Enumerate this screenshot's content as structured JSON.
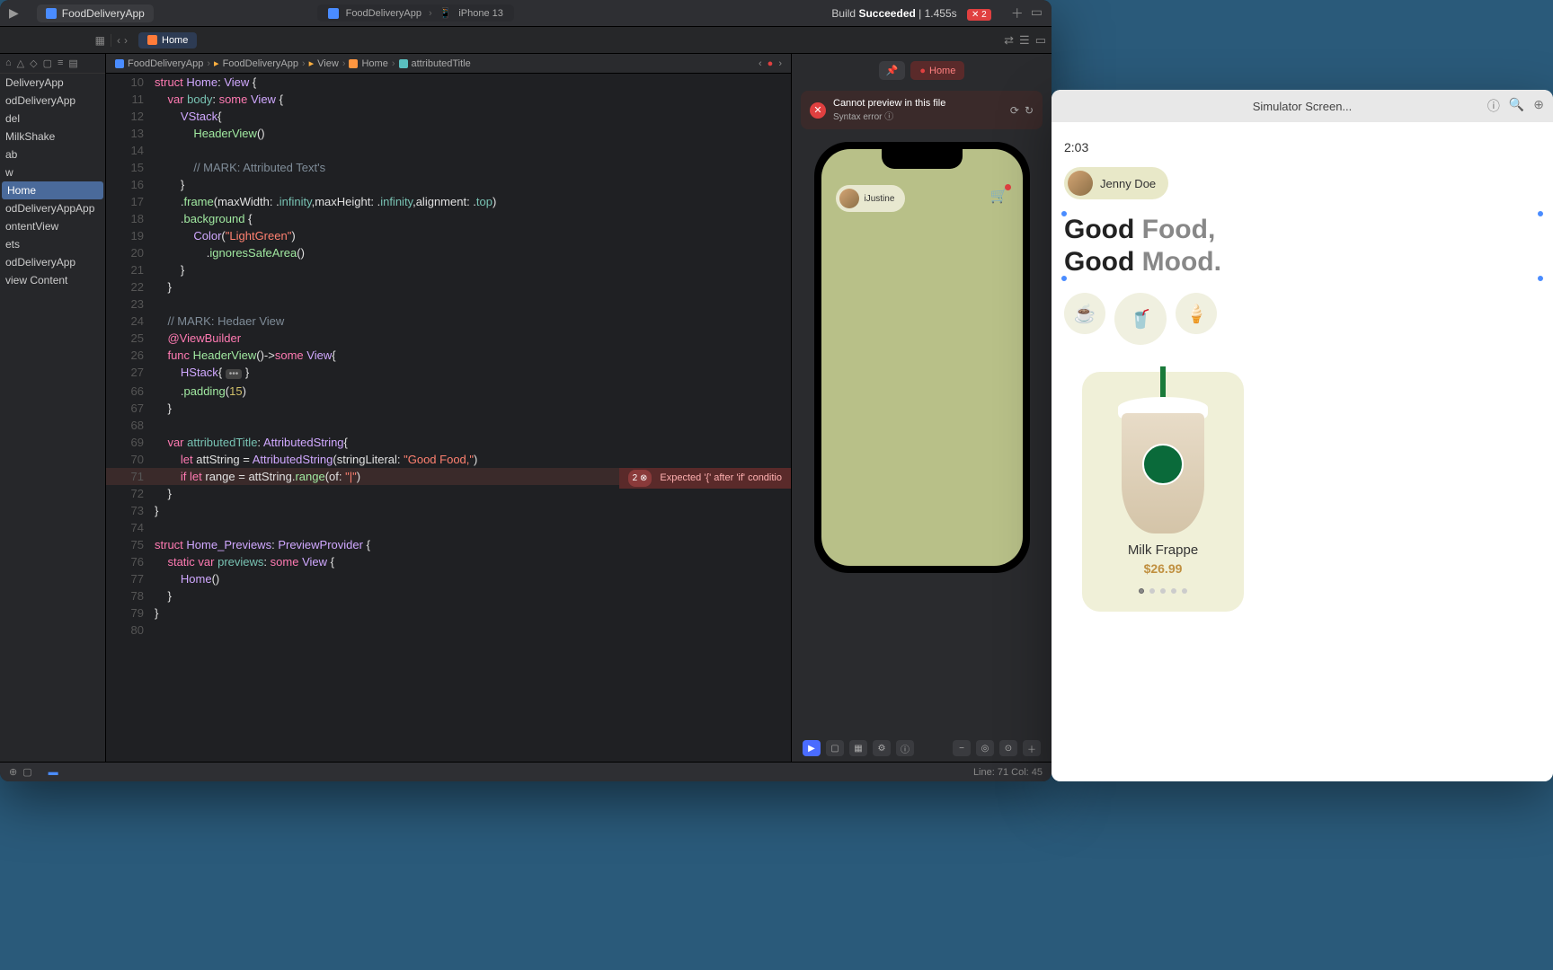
{
  "toolbar": {
    "project_name": "FoodDeliveryApp",
    "target_app": "FoodDeliveryApp",
    "target_device": "iPhone 13",
    "build_prefix": "Build",
    "build_status": "Succeeded",
    "build_time": "1.455s",
    "error_count": "2"
  },
  "tab": {
    "open_file": "Home"
  },
  "breadcrumb": {
    "items": [
      "FoodDeliveryApp",
      "FoodDeliveryApp",
      "View",
      "Home",
      "attributedTitle"
    ]
  },
  "sidebar": {
    "items": [
      "DeliveryApp",
      "odDeliveryApp",
      "del",
      "MilkShake",
      "ab",
      "w",
      "Home",
      "odDeliveryAppApp",
      "ontentView",
      "ets",
      "odDeliveryApp",
      "view Content"
    ],
    "selected_index": 6
  },
  "code": {
    "lines": [
      {
        "n": 10,
        "tokens": [
          {
            "t": "kw",
            "v": "struct"
          },
          {
            "t": "plain",
            "v": " "
          },
          {
            "t": "type",
            "v": "Home"
          },
          {
            "t": "plain",
            "v": ": "
          },
          {
            "t": "type",
            "v": "View"
          },
          {
            "t": "plain",
            "v": " {"
          }
        ]
      },
      {
        "n": 11,
        "tokens": [
          {
            "t": "plain",
            "v": "    "
          },
          {
            "t": "kw",
            "v": "var"
          },
          {
            "t": "plain",
            "v": " "
          },
          {
            "t": "ident",
            "v": "body"
          },
          {
            "t": "plain",
            "v": ": "
          },
          {
            "t": "kw",
            "v": "some"
          },
          {
            "t": "plain",
            "v": " "
          },
          {
            "t": "type",
            "v": "View"
          },
          {
            "t": "plain",
            "v": " {"
          }
        ]
      },
      {
        "n": 12,
        "tokens": [
          {
            "t": "plain",
            "v": "        "
          },
          {
            "t": "type",
            "v": "VStack"
          },
          {
            "t": "plain",
            "v": "{"
          }
        ]
      },
      {
        "n": 13,
        "tokens": [
          {
            "t": "plain",
            "v": "            "
          },
          {
            "t": "func",
            "v": "HeaderView"
          },
          {
            "t": "plain",
            "v": "()"
          }
        ]
      },
      {
        "n": 14,
        "tokens": [
          {
            "t": "plain",
            "v": ""
          }
        ]
      },
      {
        "n": 15,
        "tokens": [
          {
            "t": "plain",
            "v": "            "
          },
          {
            "t": "comment",
            "v": "// MARK: Attributed Text's"
          }
        ]
      },
      {
        "n": 16,
        "tokens": [
          {
            "t": "plain",
            "v": "        }"
          }
        ]
      },
      {
        "n": 17,
        "tokens": [
          {
            "t": "plain",
            "v": "        ."
          },
          {
            "t": "func",
            "v": "frame"
          },
          {
            "t": "plain",
            "v": "(maxWidth: ."
          },
          {
            "t": "ident",
            "v": "infinity"
          },
          {
            "t": "plain",
            "v": ",maxHeight: ."
          },
          {
            "t": "ident",
            "v": "infinity"
          },
          {
            "t": "plain",
            "v": ",alignment: ."
          },
          {
            "t": "ident",
            "v": "top"
          },
          {
            "t": "plain",
            "v": ")"
          }
        ]
      },
      {
        "n": 18,
        "tokens": [
          {
            "t": "plain",
            "v": "        ."
          },
          {
            "t": "func",
            "v": "background"
          },
          {
            "t": "plain",
            "v": " {"
          }
        ]
      },
      {
        "n": 19,
        "tokens": [
          {
            "t": "plain",
            "v": "            "
          },
          {
            "t": "type",
            "v": "Color"
          },
          {
            "t": "plain",
            "v": "("
          },
          {
            "t": "str",
            "v": "\"LightGreen\""
          },
          {
            "t": "plain",
            "v": ")"
          }
        ]
      },
      {
        "n": 20,
        "tokens": [
          {
            "t": "plain",
            "v": "                ."
          },
          {
            "t": "func",
            "v": "ignoresSafeArea"
          },
          {
            "t": "plain",
            "v": "()"
          }
        ]
      },
      {
        "n": 21,
        "tokens": [
          {
            "t": "plain",
            "v": "        }"
          }
        ]
      },
      {
        "n": 22,
        "tokens": [
          {
            "t": "plain",
            "v": "    }"
          }
        ]
      },
      {
        "n": 23,
        "tokens": [
          {
            "t": "plain",
            "v": ""
          }
        ]
      },
      {
        "n": 24,
        "tokens": [
          {
            "t": "plain",
            "v": "    "
          },
          {
            "t": "comment",
            "v": "// MARK: Hedaer View"
          }
        ]
      },
      {
        "n": 25,
        "tokens": [
          {
            "t": "plain",
            "v": "    "
          },
          {
            "t": "kw",
            "v": "@ViewBuilder"
          }
        ]
      },
      {
        "n": 26,
        "tokens": [
          {
            "t": "plain",
            "v": "    "
          },
          {
            "t": "kw",
            "v": "func"
          },
          {
            "t": "plain",
            "v": " "
          },
          {
            "t": "func",
            "v": "HeaderView"
          },
          {
            "t": "plain",
            "v": "()->"
          },
          {
            "t": "kw",
            "v": "some"
          },
          {
            "t": "plain",
            "v": " "
          },
          {
            "t": "type",
            "v": "View"
          },
          {
            "t": "plain",
            "v": "{"
          }
        ]
      },
      {
        "n": 27,
        "fold": true,
        "tokens": [
          {
            "t": "plain",
            "v": "        "
          },
          {
            "t": "type",
            "v": "HStack"
          },
          {
            "t": "plain",
            "v": "{ "
          },
          {
            "t": "fold",
            "v": "•••"
          },
          {
            "t": "plain",
            "v": " }"
          }
        ]
      },
      {
        "n": 66,
        "tokens": [
          {
            "t": "plain",
            "v": "        ."
          },
          {
            "t": "func",
            "v": "padding"
          },
          {
            "t": "plain",
            "v": "("
          },
          {
            "t": "num",
            "v": "15"
          },
          {
            "t": "plain",
            "v": ")"
          }
        ]
      },
      {
        "n": 67,
        "tokens": [
          {
            "t": "plain",
            "v": "    }"
          }
        ]
      },
      {
        "n": 68,
        "tokens": [
          {
            "t": "plain",
            "v": ""
          }
        ]
      },
      {
        "n": 69,
        "tokens": [
          {
            "t": "plain",
            "v": "    "
          },
          {
            "t": "kw",
            "v": "var"
          },
          {
            "t": "plain",
            "v": " "
          },
          {
            "t": "ident",
            "v": "attributedTitle"
          },
          {
            "t": "plain",
            "v": ": "
          },
          {
            "t": "type",
            "v": "AttributedString"
          },
          {
            "t": "plain",
            "v": "{"
          }
        ]
      },
      {
        "n": 70,
        "tokens": [
          {
            "t": "plain",
            "v": "        "
          },
          {
            "t": "kw",
            "v": "let"
          },
          {
            "t": "plain",
            "v": " attString = "
          },
          {
            "t": "type",
            "v": "AttributedString"
          },
          {
            "t": "plain",
            "v": "(stringLiteral: "
          },
          {
            "t": "str",
            "v": "\"Good Food,\""
          },
          {
            "t": "plain",
            "v": ")"
          }
        ]
      },
      {
        "n": 71,
        "err": true,
        "tokens": [
          {
            "t": "plain",
            "v": "        "
          },
          {
            "t": "kw",
            "v": "if"
          },
          {
            "t": "plain",
            "v": " "
          },
          {
            "t": "kw",
            "v": "let"
          },
          {
            "t": "plain",
            "v": " range = attString."
          },
          {
            "t": "func",
            "v": "range"
          },
          {
            "t": "plain",
            "v": "(of: "
          },
          {
            "t": "str",
            "v": "\"|\""
          },
          {
            "t": "plain",
            "v": ")"
          }
        ]
      },
      {
        "n": 72,
        "tokens": [
          {
            "t": "plain",
            "v": "    }"
          }
        ]
      },
      {
        "n": 73,
        "tokens": [
          {
            "t": "plain",
            "v": "}"
          }
        ]
      },
      {
        "n": 74,
        "tokens": [
          {
            "t": "plain",
            "v": ""
          }
        ]
      },
      {
        "n": 75,
        "tokens": [
          {
            "t": "kw",
            "v": "struct"
          },
          {
            "t": "plain",
            "v": " "
          },
          {
            "t": "type",
            "v": "Home_Previews"
          },
          {
            "t": "plain",
            "v": ": "
          },
          {
            "t": "type",
            "v": "PreviewProvider"
          },
          {
            "t": "plain",
            "v": " {"
          }
        ]
      },
      {
        "n": 76,
        "tokens": [
          {
            "t": "plain",
            "v": "    "
          },
          {
            "t": "kw",
            "v": "static"
          },
          {
            "t": "plain",
            "v": " "
          },
          {
            "t": "kw",
            "v": "var"
          },
          {
            "t": "plain",
            "v": " "
          },
          {
            "t": "ident",
            "v": "previews"
          },
          {
            "t": "plain",
            "v": ": "
          },
          {
            "t": "kw",
            "v": "some"
          },
          {
            "t": "plain",
            "v": " "
          },
          {
            "t": "type",
            "v": "View"
          },
          {
            "t": "plain",
            "v": " {"
          }
        ]
      },
      {
        "n": 77,
        "tokens": [
          {
            "t": "plain",
            "v": "        "
          },
          {
            "t": "type",
            "v": "Home"
          },
          {
            "t": "plain",
            "v": "()"
          }
        ]
      },
      {
        "n": 78,
        "tokens": [
          {
            "t": "plain",
            "v": "    }"
          }
        ]
      },
      {
        "n": 79,
        "tokens": [
          {
            "t": "plain",
            "v": "}"
          }
        ]
      },
      {
        "n": 80,
        "tokens": [
          {
            "t": "plain",
            "v": ""
          }
        ]
      }
    ],
    "inline_error": {
      "line": 71,
      "count": "2",
      "msg": "Expected '{' after 'if' conditio"
    }
  },
  "canvas": {
    "home_label": "Home",
    "banner_title": "Cannot preview in this file",
    "banner_sub": "Syntax error",
    "preview_user": "iJustine"
  },
  "status_bar": {
    "cursor": "Line: 71  Col: 45"
  },
  "simulator": {
    "title": "Simulator Screen...",
    "time": "2:03",
    "user": "Jenny Doe",
    "headline_1a": "Good ",
    "headline_1b": "Food,",
    "headline_2a": "Good ",
    "headline_2b": "Mood.",
    "product_name": "Milk Frappe",
    "product_price": "$26.99"
  }
}
